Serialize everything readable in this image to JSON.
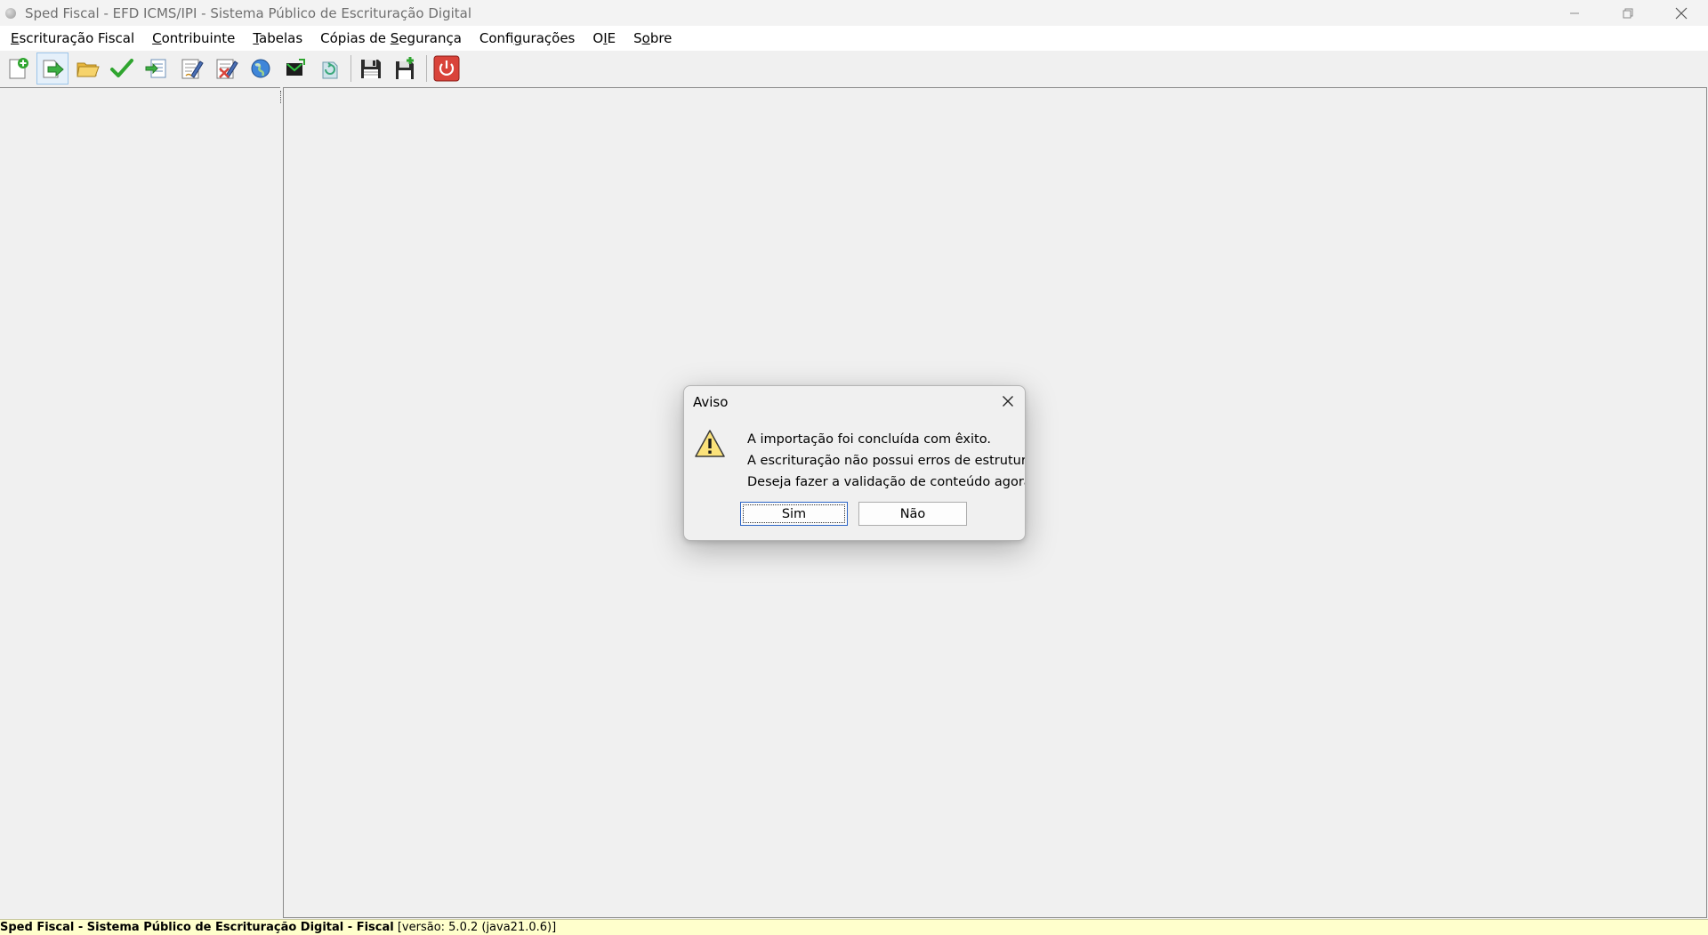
{
  "window": {
    "title": "Sped Fiscal - EFD ICMS/IPI - Sistema Público de Escrituração Digital"
  },
  "menu": [
    {
      "label": "Escrituração Fiscal",
      "mnemonic": "E",
      "rest": "scrituração Fiscal"
    },
    {
      "label": "Contribuinte",
      "mnemonic": "C",
      "rest": "ontribuinte"
    },
    {
      "label": "Tabelas",
      "mnemonic": "T",
      "rest": "abelas"
    },
    {
      "label": "Cópias de Segurança",
      "before": "Cópias de ",
      "mnemonic": "S",
      "rest": "egurança"
    },
    {
      "label": "Configurações",
      "before": "Confi",
      "mnemonic": "g",
      "rest": "urações"
    },
    {
      "label": "OIE",
      "before": "O",
      "mnemonic": "I",
      "rest": "E"
    },
    {
      "label": "Sobre",
      "before": "S",
      "mnemonic": "o",
      "rest": "bre"
    }
  ],
  "toolbar": {
    "icons": [
      "new-document-icon",
      "import-arrow-icon",
      "open-folder-icon",
      "validate-check-icon",
      "export-icon",
      "sign-icon",
      "unsign-icon",
      "globe-icon",
      "transmit-icon",
      "receipt-icon",
      "backup-save-icon",
      "restore-save-icon",
      "exit-power-icon"
    ],
    "colors": {
      "green": "#2fa52f",
      "blue": "#2d6fcf",
      "red": "#d9433a",
      "folder": "#f2c94c"
    }
  },
  "dialog": {
    "title": "Aviso",
    "line1": "A importação foi concluída com êxito.",
    "line2": "A escrituração não possui erros de estrutura.",
    "line3": "Deseja fazer a validação de conteúdo agora?",
    "yes_label": "Sim",
    "no_label": "Não"
  },
  "status": {
    "bold": "Sped Fiscal - Sistema Público de Escrituração Digital - Fiscal",
    "version": " [versão: 5.0.2 (java21.0.6)]"
  }
}
